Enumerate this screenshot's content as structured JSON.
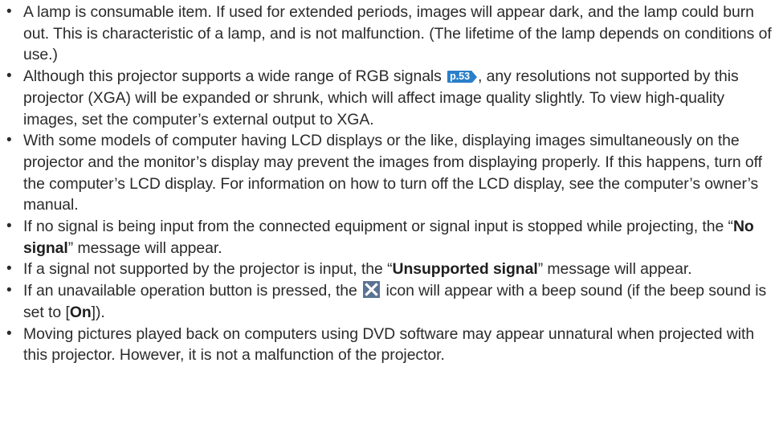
{
  "bullet_glyph": "•",
  "page_ref_color": "#2a7fc9",
  "icon_color": "#5a7394",
  "items": [
    {
      "text": "A lamp is consumable item. If used for extended periods, images will appear dark, and the lamp could burn out.  This is characteristic of a lamp, and is not malfunction. (The lifetime of the lamp depends on conditions of use.)"
    },
    {
      "before": "Although this projector supports a wide range of RGB signals ",
      "page_ref": "p.53",
      "after": ", any resolutions not supported by this projector (XGA) will be expanded or shrunk, which will affect image quality slightly. To view high-quality images, set the computer’s external output to XGA."
    },
    {
      "text": "With some models of computer having LCD displays or the like, displaying images simultaneously on the projector and the monitor’s display may prevent the images from displaying properly. If this happens, turn off the computer’s LCD display. For information on how to turn off the LCD display, see the computer’s owner’s manual."
    },
    {
      "before": "If no signal is being input from the connected equipment or signal input is stopped while projecting, the “",
      "bold": "No signal",
      "after": "” message will appear."
    },
    {
      "before": "If a signal not supported by the projector is input, the “",
      "bold": "Unsupported signal",
      "after": "” message will appear."
    },
    {
      "before": "If an unavailable operation button is pressed, the ",
      "icon": "x-mark-icon",
      "middle": " icon will appear with a beep sound (if the beep sound is set to [",
      "bold": "On",
      "after": "])."
    },
    {
      "text": "Moving pictures played back on computers using DVD software may appear unnatural when projected with this projector. However, it is not a malfunction of the projector."
    }
  ]
}
